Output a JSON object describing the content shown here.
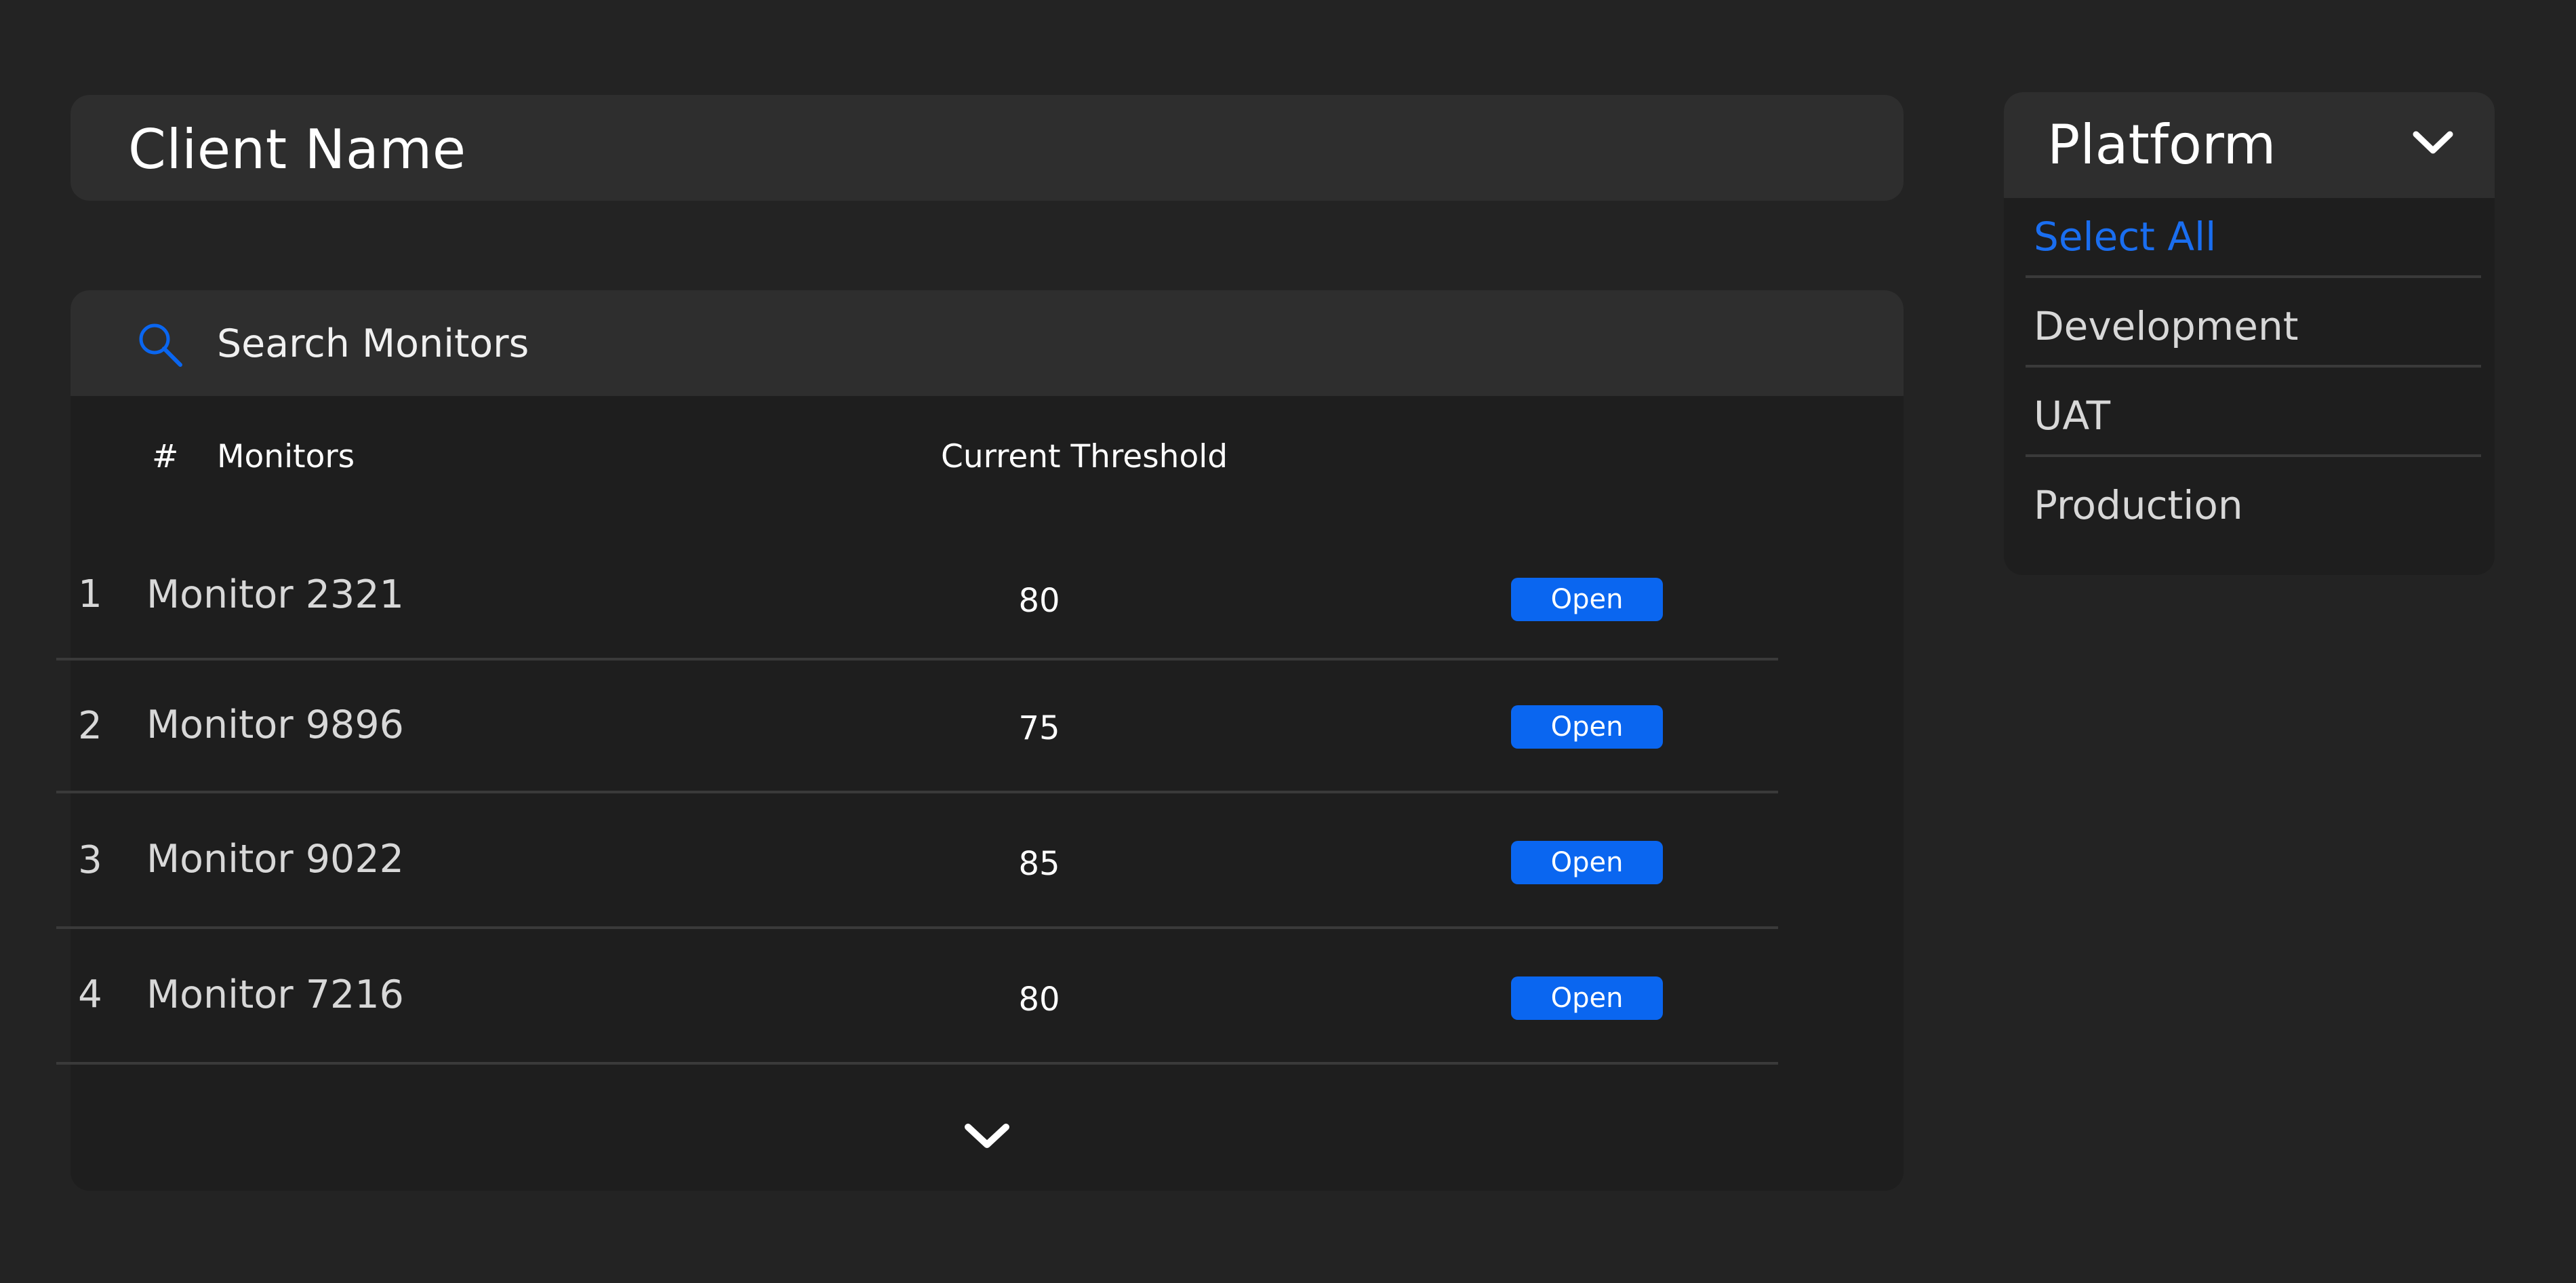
{
  "client": {
    "name_label": "Client Name"
  },
  "search": {
    "text": "Search Monitors",
    "icon": "search-icon"
  },
  "table": {
    "headers": {
      "index": "#",
      "monitors": "Monitors",
      "threshold": "Current Threshold"
    },
    "rows": [
      {
        "index": "1",
        "name": "Monitor 2321",
        "threshold": "80",
        "action": "Open"
      },
      {
        "index": "2",
        "name": "Monitor 9896",
        "threshold": "75",
        "action": "Open"
      },
      {
        "index": "3",
        "name": "Monitor 9022",
        "threshold": "85",
        "action": "Open"
      },
      {
        "index": "4",
        "name": "Monitor 7216",
        "threshold": "80",
        "action": "Open"
      }
    ],
    "expand_icon": "chevron-down-icon"
  },
  "platform": {
    "title": "Platform",
    "chevron_icon": "chevron-down-icon",
    "options": [
      {
        "label": "Select All"
      },
      {
        "label": "Development"
      },
      {
        "label": "UAT"
      },
      {
        "label": "Production"
      }
    ]
  },
  "colors": {
    "background": "#232323",
    "panel": "#1e1e1e",
    "header_bar": "#2e2e2e",
    "accent": "#0a66f0",
    "link_accent": "#1a6ef0",
    "divider": "#3a3a3a"
  }
}
